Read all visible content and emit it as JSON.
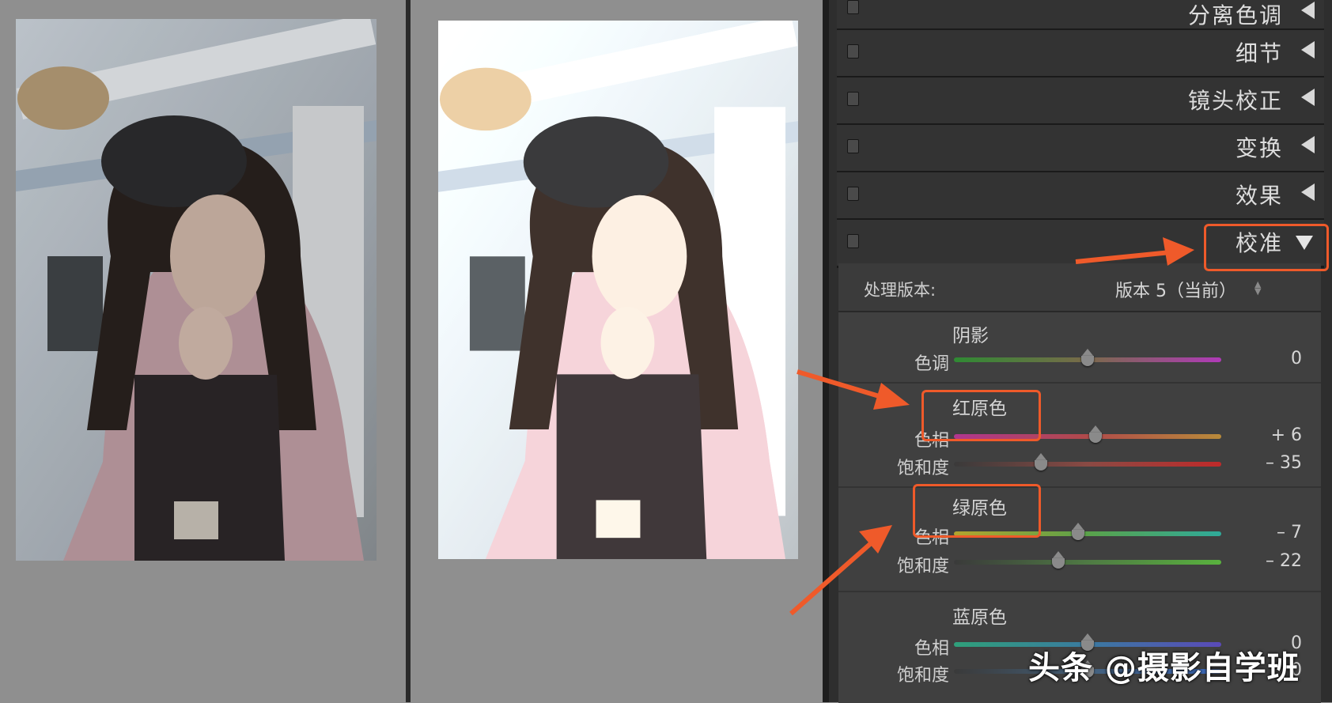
{
  "panel": {
    "sections": [
      {
        "title": "分离色调"
      },
      {
        "title": "细节"
      },
      {
        "title": "镜头校正"
      },
      {
        "title": "变换"
      },
      {
        "title": "效果"
      },
      {
        "title": "校准"
      }
    ],
    "process": {
      "label": "处理版本:",
      "value": "版本 5（当前）"
    },
    "shadows": {
      "title": "阴影",
      "tint": {
        "label": "色调",
        "value": "0",
        "level": 0
      }
    },
    "red_primary": {
      "title": "红原色",
      "hue": {
        "label": "色相",
        "value": "+ 6",
        "level": 6
      },
      "saturation": {
        "label": "饱和度",
        "value": "– 35",
        "level": -35
      }
    },
    "green_primary": {
      "title": "绿原色",
      "hue": {
        "label": "色相",
        "value": "– 7",
        "level": -7
      },
      "saturation": {
        "label": "饱和度",
        "value": "– 22",
        "level": -22
      }
    },
    "blue_primary": {
      "title": "蓝原色",
      "hue": {
        "label": "色相",
        "value": "0",
        "level": 0
      },
      "saturation": {
        "label": "饱和度",
        "value": "0",
        "level": 0
      }
    }
  },
  "watermark": "头条 @摄影自学班",
  "colors": {
    "highlight": "#ef5a2a",
    "panel_bg": "#2e2e2e"
  }
}
